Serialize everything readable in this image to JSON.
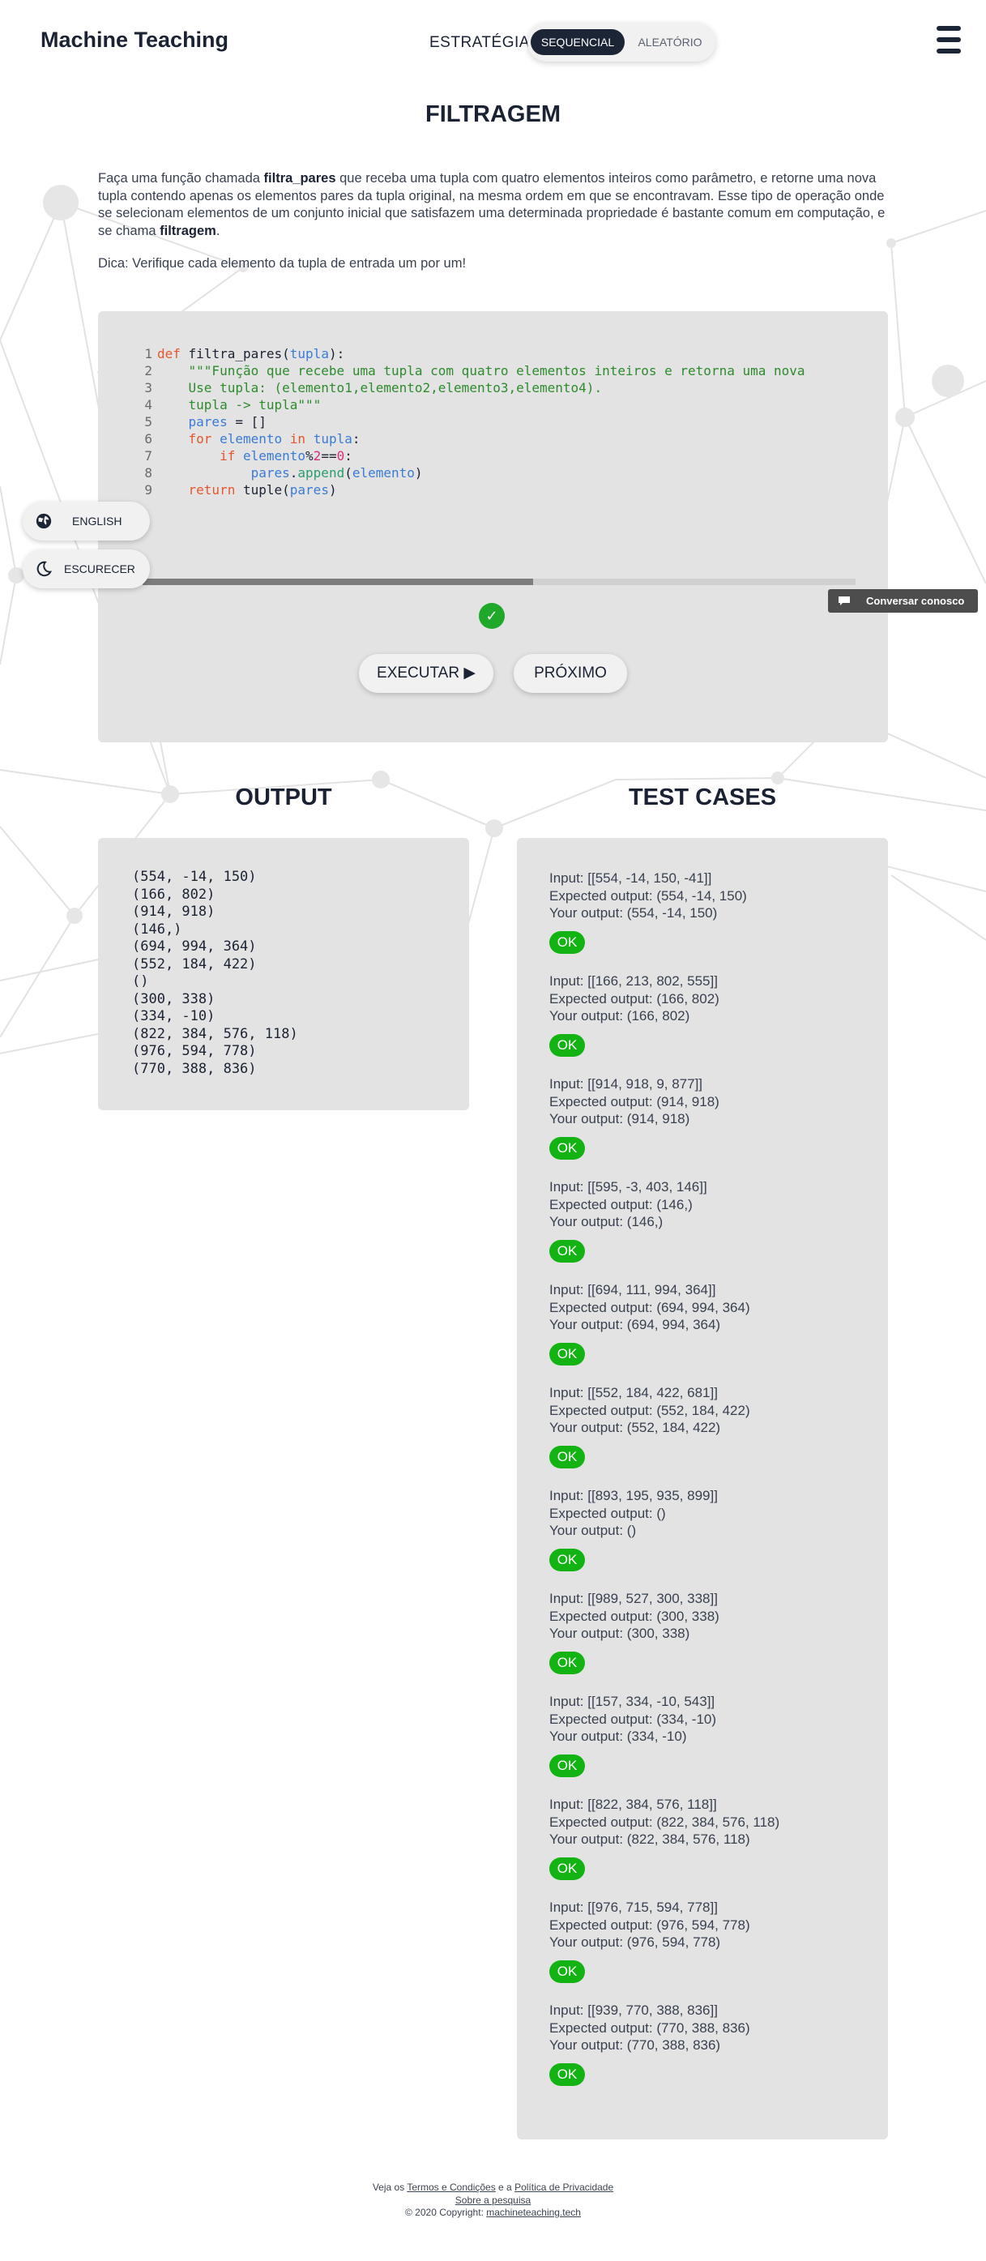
{
  "header": {
    "brand": "Machine Teaching",
    "strategy_label": "ESTRATÉGIA",
    "strategy_options": [
      "SEQUENCIAL",
      "ALEATÓRIO"
    ],
    "strategy_selected": "SEQUENCIAL",
    "menu_icon": "hamburger-menu-icon"
  },
  "exercise": {
    "title": "FILTRAGEM",
    "description": {
      "p1": "Faça uma função chamada ",
      "b1": "filtra_pares",
      "p2": " que receba uma tupla com quatro elementos inteiros como parâmetro, e retorne uma nova tupla contendo apenas os elementos pares da tupla original, na mesma ordem em que se encontravam. Esse tipo de operação onde se selecionam elementos de um conjunto inicial que satisfazem uma determinada propriedade é bastante comum em computação, e se chama ",
      "b2": "filtragem",
      "p3": "."
    },
    "tip": "Dica: Verifique cada elemento da tupla de entrada um por um!"
  },
  "editor": {
    "lines": [
      "def filtra_pares(tupla):",
      "    \"\"\"Função que recebe uma tupla com quatro elementos inteiros e retorna uma nova",
      "    Use tupla: (elemento1,elemento2,elemento3,elemento4).",
      "    tupla -> tupla\"\"\"",
      "    pares = []",
      "    for elemento in tupla:",
      "        if elemento%2==0:",
      "            pares.append(elemento)",
      "    return tuple(pares)"
    ],
    "scroll_fraction": 0.55,
    "status_icon": "check-icon",
    "run_label": "EXECUTAR ▶",
    "next_label": "PRÓXIMO"
  },
  "side_buttons": {
    "language_label": "ENGLISH",
    "language_icon": "globe-icon",
    "theme_label": "ESCURECER",
    "theme_icon": "moon-icon"
  },
  "chat": {
    "label": "Conversar conosco",
    "icon": "chat-bubble-icon"
  },
  "output": {
    "title": "OUTPUT",
    "lines": [
      "(554, -14, 150)",
      "(166, 802)",
      "(914, 918)",
      "(146,)",
      "(694, 994, 364)",
      "(552, 184, 422)",
      "()",
      "(300, 338)",
      "(334, -10)",
      "(822, 384, 576, 118)",
      "(976, 594, 778)",
      "(770, 388, 836)"
    ]
  },
  "tests": {
    "title": "TEST CASES",
    "cases": [
      {
        "input": "Input: [[554, -14, 150, -41]]",
        "expected": "Expected output: (554, -14, 150)",
        "yours": "Your output: (554, -14, 150)",
        "status": "OK"
      },
      {
        "input": "Input: [[166, 213, 802, 555]]",
        "expected": "Expected output: (166, 802)",
        "yours": "Your output: (166, 802)",
        "status": "OK"
      },
      {
        "input": "Input: [[914, 918, 9, 877]]",
        "expected": "Expected output: (914, 918)",
        "yours": "Your output: (914, 918)",
        "status": "OK"
      },
      {
        "input": "Input: [[595, -3, 403, 146]]",
        "expected": "Expected output: (146,)",
        "yours": "Your output: (146,)",
        "status": "OK"
      },
      {
        "input": "Input: [[694, 111, 994, 364]]",
        "expected": "Expected output: (694, 994, 364)",
        "yours": "Your output: (694, 994, 364)",
        "status": "OK"
      },
      {
        "input": "Input: [[552, 184, 422, 681]]",
        "expected": "Expected output: (552, 184, 422)",
        "yours": "Your output: (552, 184, 422)",
        "status": "OK"
      },
      {
        "input": "Input: [[893, 195, 935, 899]]",
        "expected": "Expected output: ()",
        "yours": "Your output: ()",
        "status": "OK"
      },
      {
        "input": "Input: [[989, 527, 300, 338]]",
        "expected": "Expected output: (300, 338)",
        "yours": "Your output: (300, 338)",
        "status": "OK"
      },
      {
        "input": "Input: [[157, 334, -10, 543]]",
        "expected": "Expected output: (334, -10)",
        "yours": "Your output: (334, -10)",
        "status": "OK"
      },
      {
        "input": "Input: [[822, 384, 576, 118]]",
        "expected": "Expected output: (822, 384, 576, 118)",
        "yours": "Your output: (822, 384, 576, 118)",
        "status": "OK"
      },
      {
        "input": "Input: [[976, 715, 594, 778]]",
        "expected": "Expected output: (976, 594, 778)",
        "yours": "Your output: (976, 594, 778)",
        "status": "OK"
      },
      {
        "input": "Input: [[939, 770, 388, 836]]",
        "expected": "Expected output: (770, 388, 836)",
        "yours": "Your output: (770, 388, 836)",
        "status": "OK"
      }
    ]
  },
  "footer": {
    "prefix": "Veja os ",
    "terms_link": "Termos e Condições",
    "middle": " e a ",
    "privacy_link": "Política de Privacidade",
    "about_link": "Sobre a pesquisa",
    "copyright": "© 2020 Copyright: ",
    "site_link": "machineteaching.tech"
  },
  "colors": {
    "accent_dark": "#1c2536",
    "ok_green": "#14b314",
    "panel_gray": "#e3e3e3"
  }
}
